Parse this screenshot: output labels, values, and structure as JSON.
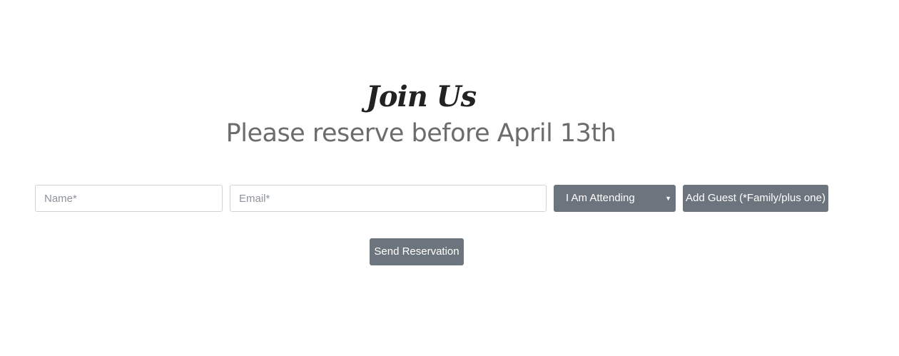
{
  "section": {
    "title": "Join Us",
    "subtitle": "Please reserve before April 13th"
  },
  "form": {
    "name_placeholder": "Name*",
    "email_placeholder": "Email*",
    "attendance_select": {
      "selected": "I Am Attending"
    },
    "add_guest_label": "Add Guest (*Family/plus one)",
    "submit_label": "Send Reservation"
  },
  "colors": {
    "button_bg": "#6c757d",
    "heading": "#222222",
    "subheading": "#6c6c6c"
  }
}
